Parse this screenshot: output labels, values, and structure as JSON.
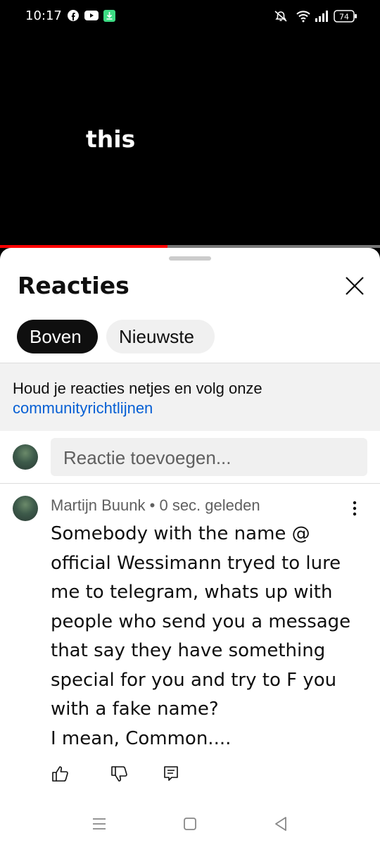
{
  "status_bar": {
    "time": "10:17",
    "battery": "74",
    "left_icons": [
      "facebook-icon",
      "youtube-icon",
      "download-icon"
    ],
    "right_icons": [
      "mute-icon",
      "wifi-icon",
      "signal-icon",
      "battery-icon"
    ]
  },
  "video": {
    "caption": "this",
    "progress": 0.44,
    "progress_color": "#ff0000"
  },
  "comments_sheet": {
    "title": "Reacties",
    "close_icon": "close-icon",
    "chips": [
      {
        "label": "Boven",
        "selected": true
      },
      {
        "label": "Nieuwste",
        "selected": false
      }
    ],
    "notice_text": "Houd je reacties netjes en volg onze",
    "notice_link": "communityrichtlijnen",
    "link_color": "#065fd4",
    "add_comment_placeholder": "Reactie toevoegen..."
  },
  "comment": {
    "author": "Martijn Buunk",
    "separator": "•",
    "time": "0 sec. geleden",
    "body": "Somebody with the name @\nofficial Wessimann tryed to lure\nme to telegram, whats up with\npeople who send you a message\nthat say they have something\nspecial for you and try to F you\nwith a fake name?\nI mean, Common....",
    "actions": [
      "like-icon",
      "dislike-icon",
      "reply-icon"
    ]
  },
  "nav_bar": {
    "buttons": [
      "menu-icon",
      "home-icon",
      "back-icon"
    ]
  }
}
